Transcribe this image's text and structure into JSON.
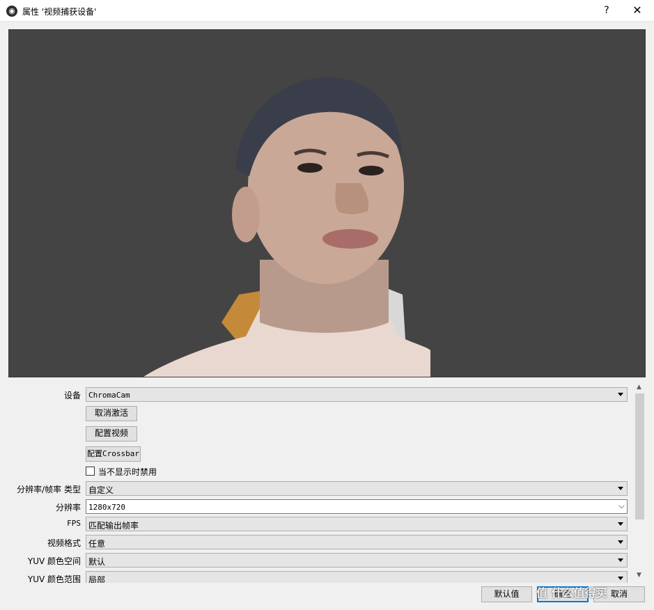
{
  "window": {
    "title": "属性 '视频捕获设备'",
    "help_label": "?",
    "close_label": "✕"
  },
  "properties": {
    "device": {
      "label": "设备",
      "value": "ChromaCam"
    },
    "deactivate_button": "取消激活",
    "configure_video_button": "配置视频",
    "configure_crossbar_button": "配置Crossbar",
    "deactivate_when_hidden": {
      "label": "当不显示时禁用",
      "checked": false
    },
    "res_fps_type": {
      "label": "分辨率/帧率 类型",
      "value": "自定义"
    },
    "resolution": {
      "label": "分辨率",
      "value": "1280x720"
    },
    "fps": {
      "label": "FPS",
      "value": "匹配输出帧率"
    },
    "video_format": {
      "label": "视频格式",
      "value": "任意"
    },
    "yuv_color_space": {
      "label": "YUV 颜色空间",
      "value": "默认"
    },
    "yuv_color_range": {
      "label": "YUV 颜色范围",
      "value": "局部"
    }
  },
  "footer": {
    "defaults_button": "默认值",
    "ok_button": "确定",
    "cancel_button": "取消"
  },
  "watermark": "值 什么值得买",
  "colors": {
    "preview_background": "#444444",
    "primary_button_border": "#0078d7"
  }
}
